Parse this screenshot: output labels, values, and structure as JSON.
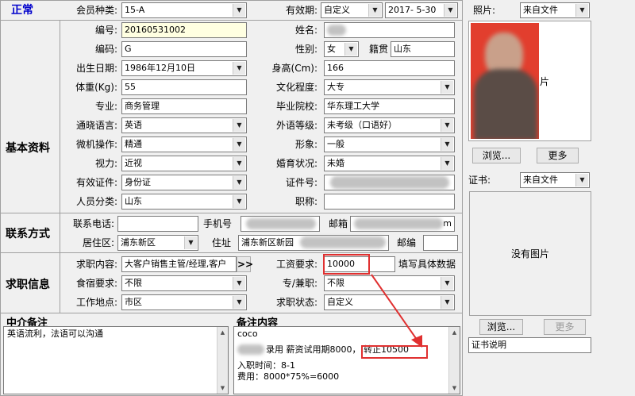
{
  "status": "正常",
  "member_type": {
    "label": "会员种类:",
    "value": "15-A"
  },
  "validity": {
    "label": "有效期:",
    "type_value": "自定义",
    "date_value": "2017- 5-30"
  },
  "basic": {
    "section_title": "基本资料",
    "number": {
      "label": "编号:",
      "value": "20160531002"
    },
    "name": {
      "label": "姓名:"
    },
    "code": {
      "label": "编码:",
      "value": "G"
    },
    "gender": {
      "label": "性别:",
      "value": "女"
    },
    "native_place": {
      "label": "籍贯",
      "value": "山东"
    },
    "birth_date": {
      "label": "出生日期:",
      "value": "1986年12月10日"
    },
    "height": {
      "label": "身高(Cm):",
      "value": "166"
    },
    "weight": {
      "label": "体重(Kg):",
      "value": "55"
    },
    "education": {
      "label": "文化程度:",
      "value": "大专"
    },
    "major": {
      "label": "专业:",
      "value": "商务管理"
    },
    "school": {
      "label": "毕业院校:",
      "value": "华东理工大学"
    },
    "language": {
      "label": "通晓语言:",
      "value": "英语"
    },
    "foreign_level": {
      "label": "外语等级:",
      "value": "未考级（口语好）"
    },
    "computer": {
      "label": "微机操作:",
      "value": "精通"
    },
    "appearance": {
      "label": "形象:",
      "value": "一般"
    },
    "vision": {
      "label": "视力:",
      "value": "近视"
    },
    "marital": {
      "label": "婚育状况:",
      "value": "未婚"
    },
    "id_type": {
      "label": "有效证件:",
      "value": "身份证"
    },
    "id_number": {
      "label": "证件号:"
    },
    "category": {
      "label": "人员分类:",
      "value": "山东"
    },
    "title": {
      "label": "职称:",
      "value": ""
    }
  },
  "contact": {
    "section_title": "联系方式",
    "phone": {
      "label": "联系电话:",
      "value": ""
    },
    "mobile": {
      "label": "手机号"
    },
    "email": {
      "label": "邮箱",
      "suffix": "m"
    },
    "district": {
      "label": "居住区:",
      "value": "浦东新区"
    },
    "address": {
      "label": "住址",
      "value": "浦东新区新园"
    },
    "postcode": {
      "label": "邮编",
      "value": ""
    }
  },
  "job": {
    "section_title": "求职信息",
    "content": {
      "label": "求职内容:",
      "value": "大客户销售主管/经理,客户",
      "more": ">>"
    },
    "salary": {
      "label": "工资要求:",
      "value": "10000",
      "hint": "填写具体数据"
    },
    "room_board": {
      "label": "食宿要求:",
      "value": "不限"
    },
    "fulltime": {
      "label": "专/兼职:",
      "value": "不限"
    },
    "location": {
      "label": "工作地点:",
      "value": "市区"
    },
    "job_status": {
      "label": "求职状态:",
      "value": "自定义"
    }
  },
  "agent_notes": {
    "title": "中介备注",
    "text": "英语流利，法语可以沟通"
  },
  "notes": {
    "title": "备注内容",
    "lines": [
      "coco",
      "录用 薪资试用期8000，",
      "转正10500",
      "入职时间：8-1",
      "费用：8000*75%=6000"
    ]
  },
  "photo": {
    "label": "照片:",
    "source": "来自文件",
    "suffix": "片",
    "browse": "浏览...",
    "more": "更多"
  },
  "certificate": {
    "label": "证书:",
    "source": "来自文件",
    "no_image": "没有图片",
    "browse": "浏览...",
    "more": "更多",
    "desc": "证书说明"
  },
  "colors": {
    "accent_title": "#0000cc",
    "annotation": "#e03030"
  }
}
